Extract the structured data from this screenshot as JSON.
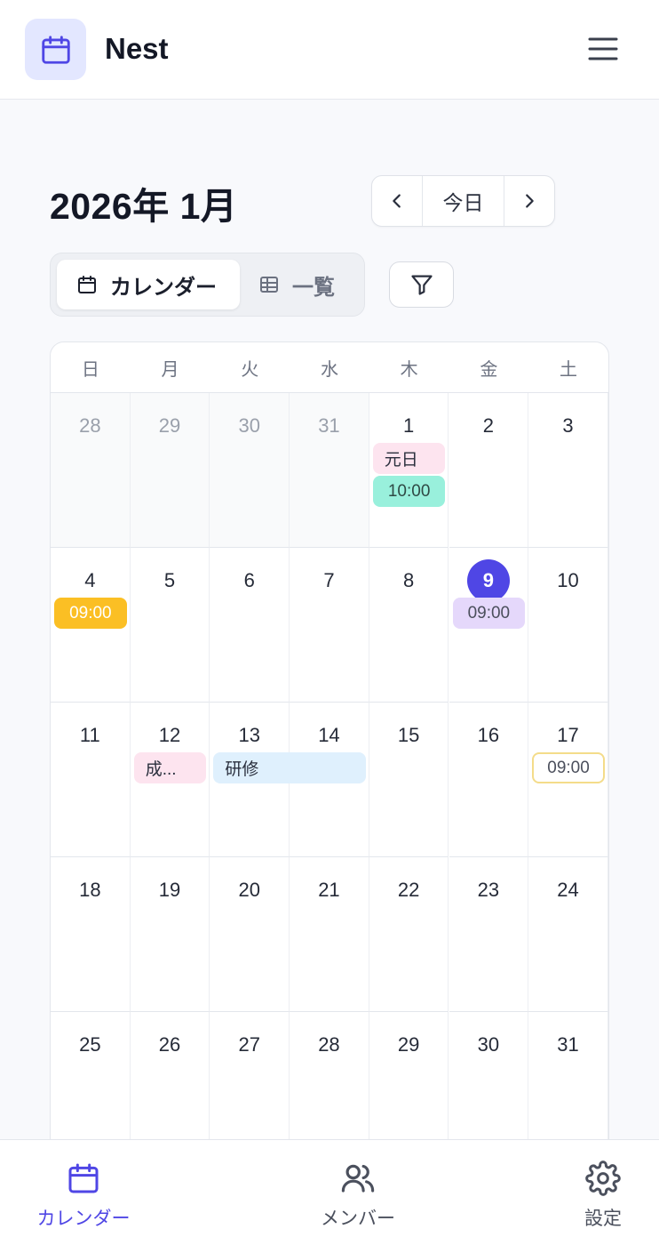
{
  "app": {
    "title": "Nest",
    "logo_icon": "calendar-icon",
    "menu_icon": "hamburger-menu-icon"
  },
  "toolbar": {
    "month_title": "2026年 1月",
    "prev_icon": "chevron-left-icon",
    "today_label": "今日",
    "next_icon": "chevron-right-icon",
    "view_calendar_label": "カレンダー",
    "view_list_label": "一覧",
    "active_view": "カレンダー",
    "filter_icon": "filter-icon"
  },
  "calendar": {
    "weekdays": [
      "日",
      "月",
      "火",
      "水",
      "木",
      "金",
      "土"
    ],
    "today": 9,
    "weeks": [
      [
        {
          "d": "28",
          "prev": true
        },
        {
          "d": "29",
          "prev": true
        },
        {
          "d": "30",
          "prev": true
        },
        {
          "d": "31",
          "prev": true
        },
        {
          "d": "1"
        },
        {
          "d": "2"
        },
        {
          "d": "3"
        }
      ],
      [
        {
          "d": "4"
        },
        {
          "d": "5"
        },
        {
          "d": "6"
        },
        {
          "d": "7"
        },
        {
          "d": "8"
        },
        {
          "d": "9",
          "today": true
        },
        {
          "d": "10"
        }
      ],
      [
        {
          "d": "11"
        },
        {
          "d": "12"
        },
        {
          "d": "13"
        },
        {
          "d": "14"
        },
        {
          "d": "15"
        },
        {
          "d": "16"
        },
        {
          "d": "17"
        }
      ],
      [
        {
          "d": "18"
        },
        {
          "d": "19"
        },
        {
          "d": "20"
        },
        {
          "d": "21"
        },
        {
          "d": "22"
        },
        {
          "d": "23"
        },
        {
          "d": "24"
        }
      ],
      [
        {
          "d": "25"
        },
        {
          "d": "26"
        },
        {
          "d": "27"
        },
        {
          "d": "28"
        },
        {
          "d": "29"
        },
        {
          "d": "30"
        },
        {
          "d": "31"
        }
      ]
    ],
    "events": [
      {
        "week": 0,
        "col": 4,
        "span": 1,
        "row": 0,
        "label": "元日",
        "bg": "#fde4ef",
        "fg": "#2a2f3d",
        "align": "left"
      },
      {
        "week": 0,
        "col": 4,
        "span": 1,
        "row": 1,
        "label": "10:00",
        "bg": "#99f0dc",
        "fg": "#2f4a45",
        "align": "center"
      },
      {
        "week": 1,
        "col": 0,
        "span": 1,
        "row": 0,
        "label": "09:00",
        "bg": "#fbbf24",
        "fg": "#ffffff",
        "align": "center"
      },
      {
        "week": 1,
        "col": 5,
        "span": 1,
        "row": 0,
        "label": "09:00",
        "bg": "#e5d8fb",
        "fg": "#4b4f5c",
        "align": "center"
      },
      {
        "week": 2,
        "col": 1,
        "span": 1,
        "row": 0,
        "label": "成...",
        "bg": "#fde4ef",
        "fg": "#2a2f3d",
        "align": "left"
      },
      {
        "week": 2,
        "col": 2,
        "span": 2,
        "row": 0,
        "label": "研修",
        "bg": "#dff0fd",
        "fg": "#2a2f3d",
        "align": "left"
      },
      {
        "week": 2,
        "col": 6,
        "span": 1,
        "row": 0,
        "label": "09:00",
        "bg": "#ffffff",
        "fg": "#4b4f5c",
        "border": "#f4dc8a",
        "align": "center"
      }
    ]
  },
  "bottom_nav": {
    "items": [
      {
        "label": "カレンダー",
        "icon": "calendar-icon",
        "active": true
      },
      {
        "label": "メンバー",
        "icon": "users-icon",
        "active": false
      },
      {
        "label": "設定",
        "icon": "gear-icon",
        "active": false
      }
    ]
  },
  "colors": {
    "accent": "#4f46e5",
    "logo_bg": "#e3e7ff",
    "today_circle": "#4f46e5"
  }
}
